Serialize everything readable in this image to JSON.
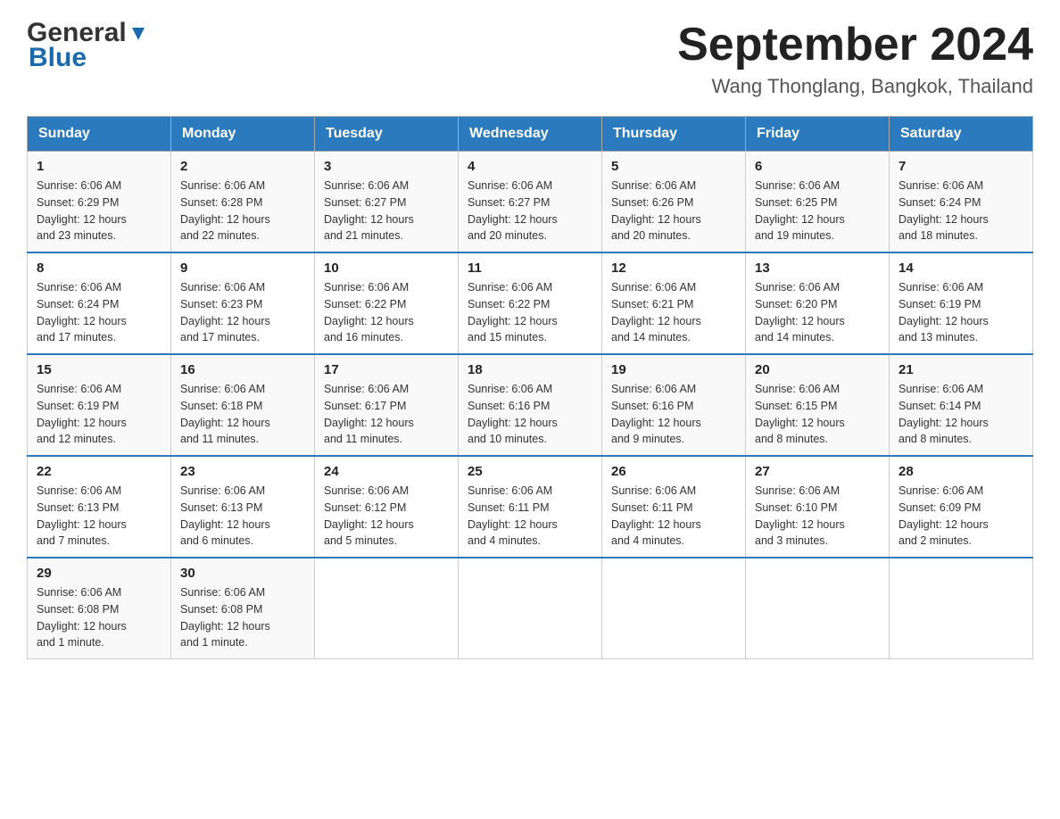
{
  "header": {
    "logo_general": "General",
    "logo_blue": "Blue",
    "month_title": "September 2024",
    "location": "Wang Thonglang, Bangkok, Thailand"
  },
  "days_of_week": [
    "Sunday",
    "Monday",
    "Tuesday",
    "Wednesday",
    "Thursday",
    "Friday",
    "Saturday"
  ],
  "weeks": [
    [
      {
        "day": "1",
        "sunrise": "6:06 AM",
        "sunset": "6:29 PM",
        "daylight": "12 hours and 23 minutes."
      },
      {
        "day": "2",
        "sunrise": "6:06 AM",
        "sunset": "6:28 PM",
        "daylight": "12 hours and 22 minutes."
      },
      {
        "day": "3",
        "sunrise": "6:06 AM",
        "sunset": "6:27 PM",
        "daylight": "12 hours and 21 minutes."
      },
      {
        "day": "4",
        "sunrise": "6:06 AM",
        "sunset": "6:27 PM",
        "daylight": "12 hours and 20 minutes."
      },
      {
        "day": "5",
        "sunrise": "6:06 AM",
        "sunset": "6:26 PM",
        "daylight": "12 hours and 20 minutes."
      },
      {
        "day": "6",
        "sunrise": "6:06 AM",
        "sunset": "6:25 PM",
        "daylight": "12 hours and 19 minutes."
      },
      {
        "day": "7",
        "sunrise": "6:06 AM",
        "sunset": "6:24 PM",
        "daylight": "12 hours and 18 minutes."
      }
    ],
    [
      {
        "day": "8",
        "sunrise": "6:06 AM",
        "sunset": "6:24 PM",
        "daylight": "12 hours and 17 minutes."
      },
      {
        "day": "9",
        "sunrise": "6:06 AM",
        "sunset": "6:23 PM",
        "daylight": "12 hours and 17 minutes."
      },
      {
        "day": "10",
        "sunrise": "6:06 AM",
        "sunset": "6:22 PM",
        "daylight": "12 hours and 16 minutes."
      },
      {
        "day": "11",
        "sunrise": "6:06 AM",
        "sunset": "6:22 PM",
        "daylight": "12 hours and 15 minutes."
      },
      {
        "day": "12",
        "sunrise": "6:06 AM",
        "sunset": "6:21 PM",
        "daylight": "12 hours and 14 minutes."
      },
      {
        "day": "13",
        "sunrise": "6:06 AM",
        "sunset": "6:20 PM",
        "daylight": "12 hours and 14 minutes."
      },
      {
        "day": "14",
        "sunrise": "6:06 AM",
        "sunset": "6:19 PM",
        "daylight": "12 hours and 13 minutes."
      }
    ],
    [
      {
        "day": "15",
        "sunrise": "6:06 AM",
        "sunset": "6:19 PM",
        "daylight": "12 hours and 12 minutes."
      },
      {
        "day": "16",
        "sunrise": "6:06 AM",
        "sunset": "6:18 PM",
        "daylight": "12 hours and 11 minutes."
      },
      {
        "day": "17",
        "sunrise": "6:06 AM",
        "sunset": "6:17 PM",
        "daylight": "12 hours and 11 minutes."
      },
      {
        "day": "18",
        "sunrise": "6:06 AM",
        "sunset": "6:16 PM",
        "daylight": "12 hours and 10 minutes."
      },
      {
        "day": "19",
        "sunrise": "6:06 AM",
        "sunset": "6:16 PM",
        "daylight": "12 hours and 9 minutes."
      },
      {
        "day": "20",
        "sunrise": "6:06 AM",
        "sunset": "6:15 PM",
        "daylight": "12 hours and 8 minutes."
      },
      {
        "day": "21",
        "sunrise": "6:06 AM",
        "sunset": "6:14 PM",
        "daylight": "12 hours and 8 minutes."
      }
    ],
    [
      {
        "day": "22",
        "sunrise": "6:06 AM",
        "sunset": "6:13 PM",
        "daylight": "12 hours and 7 minutes."
      },
      {
        "day": "23",
        "sunrise": "6:06 AM",
        "sunset": "6:13 PM",
        "daylight": "12 hours and 6 minutes."
      },
      {
        "day": "24",
        "sunrise": "6:06 AM",
        "sunset": "6:12 PM",
        "daylight": "12 hours and 5 minutes."
      },
      {
        "day": "25",
        "sunrise": "6:06 AM",
        "sunset": "6:11 PM",
        "daylight": "12 hours and 4 minutes."
      },
      {
        "day": "26",
        "sunrise": "6:06 AM",
        "sunset": "6:11 PM",
        "daylight": "12 hours and 4 minutes."
      },
      {
        "day": "27",
        "sunrise": "6:06 AM",
        "sunset": "6:10 PM",
        "daylight": "12 hours and 3 minutes."
      },
      {
        "day": "28",
        "sunrise": "6:06 AM",
        "sunset": "6:09 PM",
        "daylight": "12 hours and 2 minutes."
      }
    ],
    [
      {
        "day": "29",
        "sunrise": "6:06 AM",
        "sunset": "6:08 PM",
        "daylight": "12 hours and 1 minute."
      },
      {
        "day": "30",
        "sunrise": "6:06 AM",
        "sunset": "6:08 PM",
        "daylight": "12 hours and 1 minute."
      },
      null,
      null,
      null,
      null,
      null
    ]
  ],
  "labels": {
    "sunrise": "Sunrise:",
    "sunset": "Sunset:",
    "daylight": "Daylight:"
  }
}
